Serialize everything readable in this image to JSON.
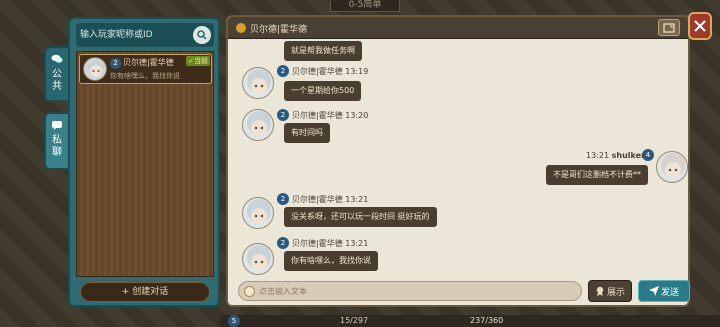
{
  "scene": {
    "top_label": "0-5简单",
    "bottom_level": "5",
    "bottom_page": "15/297",
    "bottom_resource": "237/360"
  },
  "tabs": [
    {
      "label_top": "公",
      "label_bottom": "共",
      "icon": "chat-bubbles-icon"
    },
    {
      "label_top": "私",
      "label_bottom": "聊",
      "icon": "private-chat-icon"
    }
  ],
  "search": {
    "placeholder": "输入玩家昵称或ID"
  },
  "conversations": [
    {
      "level": "2",
      "name": "贝尔德|霍华德",
      "badge": "✓当前",
      "preview": "你有啥嘿么，我找你说"
    }
  ],
  "create_button": {
    "label": "+ 创建对话"
  },
  "chat": {
    "title": "贝尔德|霍华德",
    "messages": [
      {
        "side": "left",
        "level": "",
        "sender": "",
        "time": "",
        "text": "就是帮我做任务啊"
      },
      {
        "side": "left",
        "level": "2",
        "sender": "贝尔德|霍华德",
        "time": "13:19",
        "text": "一个星期给你500"
      },
      {
        "side": "left",
        "level": "2",
        "sender": "贝尔德|霍华德",
        "time": "13:20",
        "text": "有时间吗"
      },
      {
        "side": "right",
        "level": "4",
        "sender": "shulker",
        "time": "13:21",
        "text": "不是哥们这删档不计费**"
      },
      {
        "side": "left",
        "level": "2",
        "sender": "贝尔德|霍华德",
        "time": "13:21",
        "text": "没关系呀，还可以玩一段时间 挺好玩的"
      },
      {
        "side": "left",
        "level": "2",
        "sender": "贝尔德|霍华德",
        "time": "13:21",
        "text": "你有啥嘿么，我找你说"
      }
    ]
  },
  "input": {
    "placeholder": "点击输入文本"
  },
  "show_button": {
    "label": "展示"
  },
  "send_button": {
    "label": "发送"
  },
  "colors": {
    "accent_teal": "#2a7a88",
    "bubble": "#4a3e30",
    "close_red": "#a03a28"
  }
}
